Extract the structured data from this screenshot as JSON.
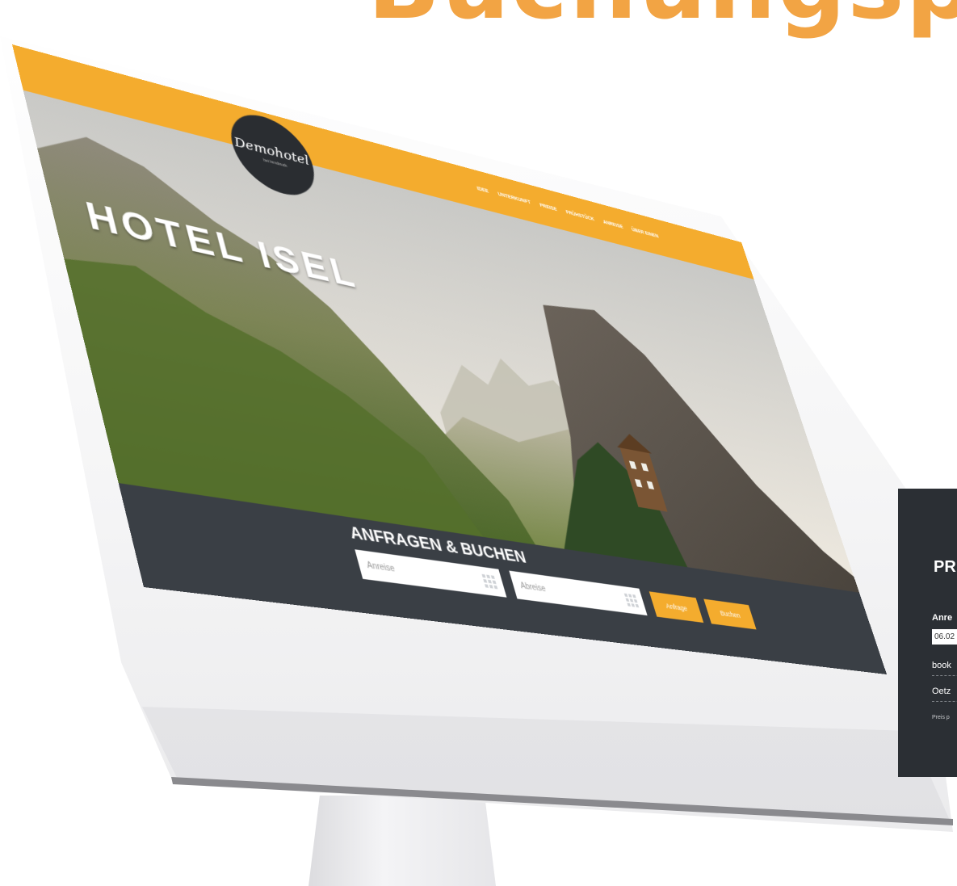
{
  "banner": {
    "title": "Buchungsp",
    "color": "#f2a444"
  },
  "site": {
    "logo": {
      "name": "Demohotel",
      "subtitle": "bei Innsbruck"
    },
    "nav": [
      {
        "label": "Idee"
      },
      {
        "label": "Unterkunft"
      },
      {
        "label": "Preise"
      },
      {
        "label": "Frühstück"
      },
      {
        "label": "Anreise"
      },
      {
        "label": "Über einen"
      }
    ],
    "hero_title": "HOTEL ISEL",
    "booking": {
      "title": "ANFRAGEN & BUCHEN",
      "arrival_placeholder": "Anreise",
      "departure_placeholder": "Abreise",
      "inquiry_label": "Anfrage",
      "book_label": "Buchen"
    },
    "colors": {
      "accent": "#f4ac2e",
      "dark": "#3a3f45"
    }
  },
  "price_widget": {
    "title": "PR",
    "arrival_label": "Anre",
    "arrival_value": "06.02",
    "row1": "book",
    "row2": "Oetz",
    "note": "Preis p"
  }
}
